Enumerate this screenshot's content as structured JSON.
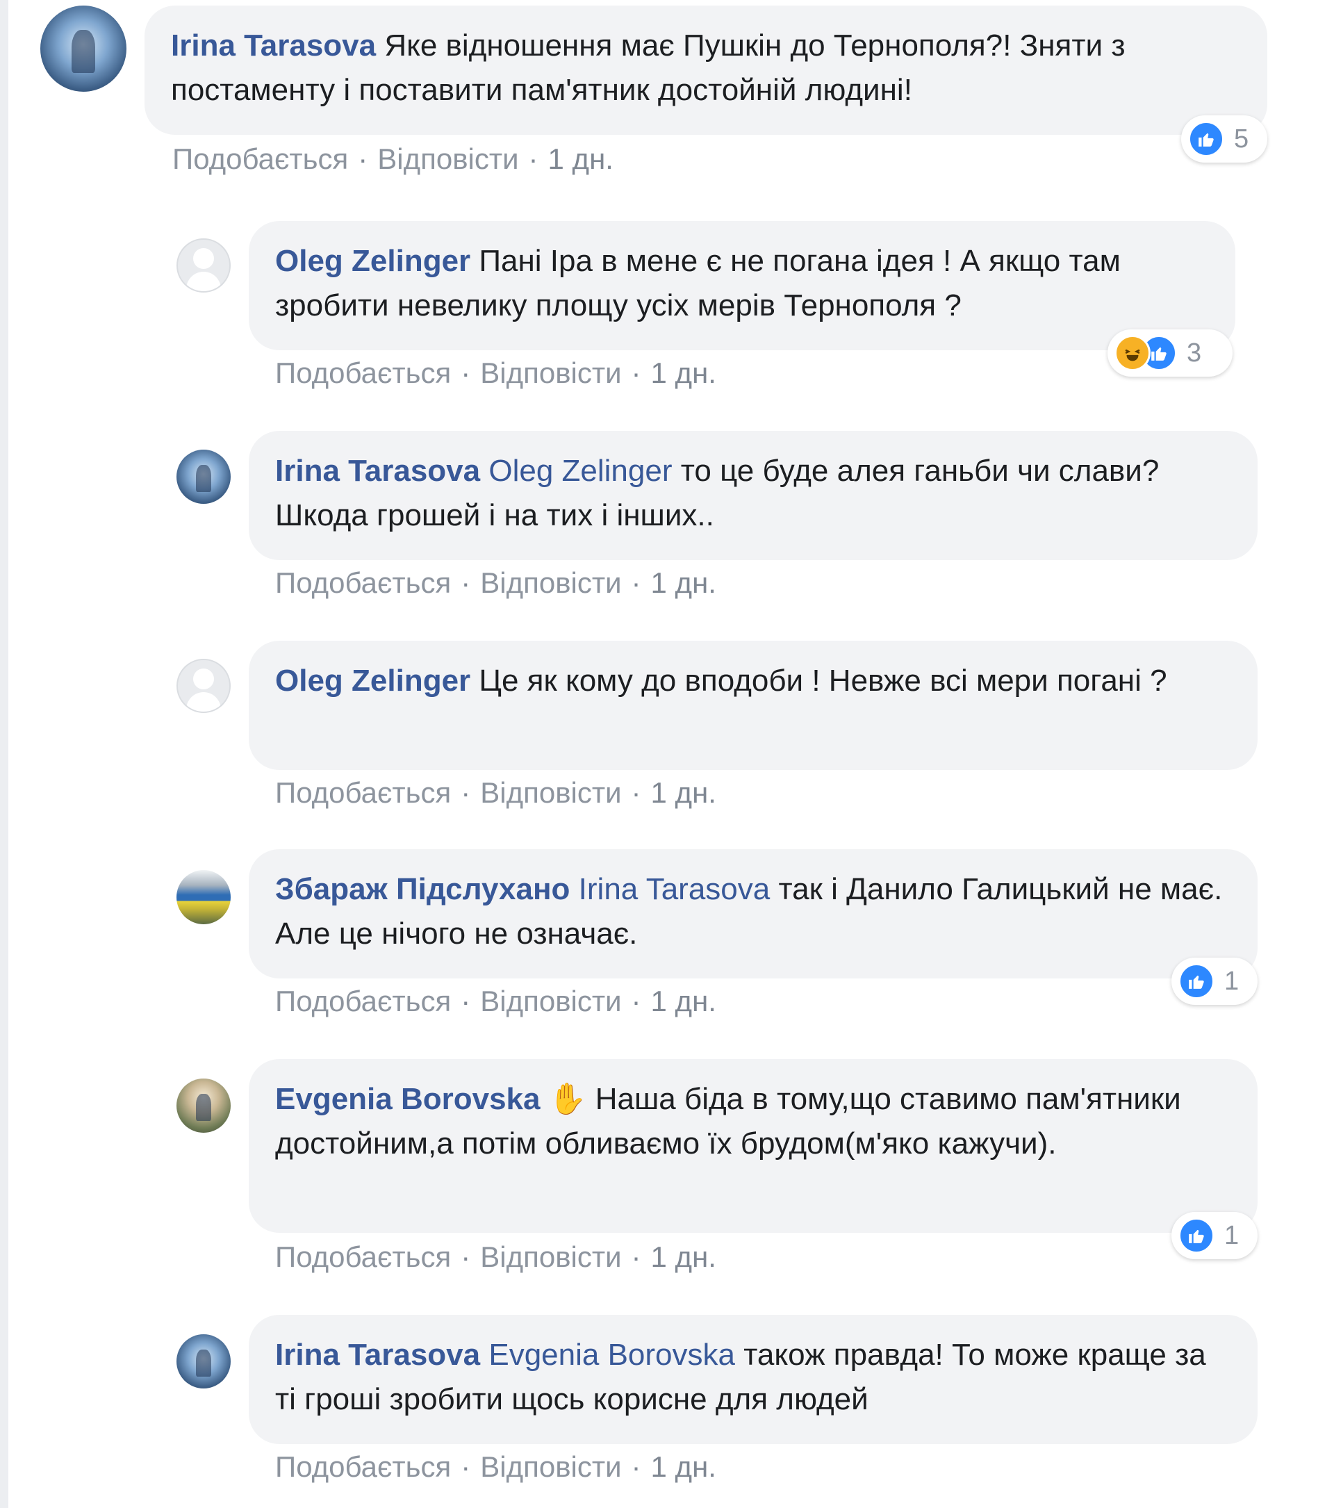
{
  "actions": {
    "like": "Подобається",
    "reply": "Відповісти",
    "sep": "·"
  },
  "colors": {
    "author": "#385898",
    "bubble": "#f2f3f5",
    "like": "#2d88ff",
    "haha": "#f7b125"
  },
  "comments": [
    {
      "author": "Irina Tarasova",
      "mention": "",
      "text": "Яке відношення має Пушкін до Тернополя?! Зняти з постаменту і поставити пам'ятник достойній людині!",
      "time": "1 дн.",
      "reactions": {
        "icons": [
          "like-icon"
        ],
        "count": "5"
      }
    },
    {
      "author": "Oleg Zelinger",
      "mention": "",
      "text": "Пані Іра в мене є не погана ідея ! А якщо там зробити невелику площу усіх мерів Тернополя ?",
      "time": "1 дн.",
      "reactions": {
        "icons": [
          "haha-icon",
          "like-icon"
        ],
        "count": "3"
      }
    },
    {
      "author": "Irina Tarasova",
      "mention": "Oleg Zelinger",
      "text": "то це буде алея ганьби чи слави? Шкода грошей і на тих і інших..",
      "time": "1 дн."
    },
    {
      "author": "Oleg Zelinger",
      "mention": "",
      "text": "Це як кому до вподоби ! Невже всі мери погані ?",
      "time": "1 дн."
    },
    {
      "author": "Збараж Підслухано",
      "mention": "Irina Tarasova",
      "text": "так і Данило Галицький не має. Але це нічого не означає.",
      "time": "1 дн.",
      "reactions": {
        "icons": [
          "like-icon"
        ],
        "count": "1"
      }
    },
    {
      "author": "Evgenia Borovska",
      "mention": "",
      "emoji": "✋",
      "text": "Наша біда в тому,що ставимо пам'ятники достойним,а потім обливаємо їх брудом(м'яко кажучи).",
      "time": "1 дн.",
      "reactions": {
        "icons": [
          "like-icon"
        ],
        "count": "1"
      }
    },
    {
      "author": "Irina Tarasova",
      "mention": "Evgenia Borovska",
      "text": "також правда! То може краще за ті гроші зробити щось корисне для людей",
      "time": "1 дн."
    }
  ]
}
